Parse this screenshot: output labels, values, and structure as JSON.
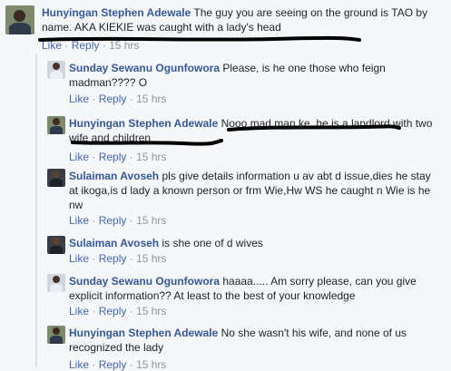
{
  "comments": [
    {
      "author": "Hunyingan Stephen Adewale",
      "text": "The guy you are seeing on the ground is TAO by name. AKA KIEKIE was caught with a lady's head",
      "like": "Like",
      "reply": "Reply",
      "time": "15 hrs"
    },
    {
      "author": "Sunday Sewanu Ogunfowora",
      "text": "Please, is he one those who feign madman???? O",
      "like": "Like",
      "reply": "Reply",
      "time": "15 hrs"
    },
    {
      "author": "Hunyingan Stephen Adewale",
      "text": "Nooo mad man ke, he is a landlord with two wife and children",
      "like": "Like",
      "reply": "Reply",
      "time": "15 hrs"
    },
    {
      "author": "Sulaiman Avoseh",
      "text": "pls give details information u av abt d issue,dies he stay at ikoga,is d lady a known person or frm Wie,Hw WS he caught n Wie is he nw",
      "like": "Like",
      "reply": "Reply",
      "time": "15 hrs"
    },
    {
      "author": "Sulaiman Avoseh",
      "text": "is she one of d wives",
      "like": "Like",
      "reply": "Reply",
      "time": "15 hrs"
    },
    {
      "author": "Sunday Sewanu Ogunfowora",
      "text": "haaaa..... Am sorry please, can you give explicit information?? At least to the best of your knowledge",
      "like": "Like",
      "reply": "Reply",
      "time": "15 hrs"
    },
    {
      "author": "Hunyingan Stephen Adewale",
      "text": "No she wasn't his wife, and none of us recognized the lady",
      "like": "Like",
      "reply": "Reply",
      "time": "15 hrs"
    }
  ],
  "colors": {
    "author": "#365899",
    "link": "#4267b2",
    "meta": "#90949c",
    "scribble": "#000000"
  }
}
